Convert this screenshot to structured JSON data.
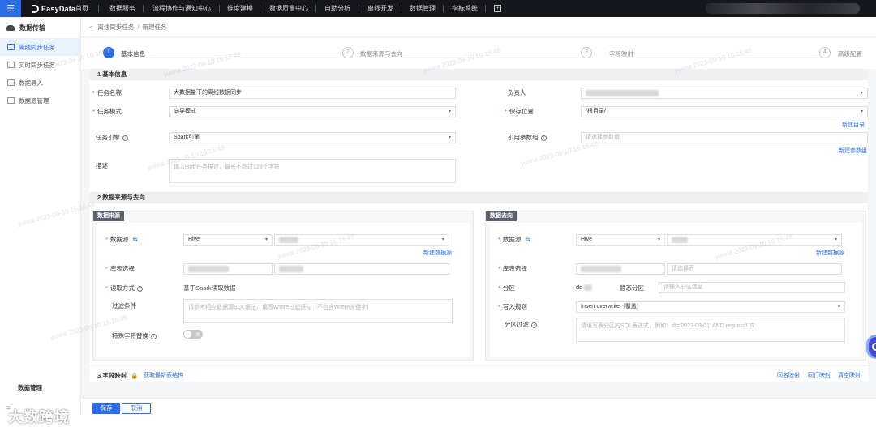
{
  "topbar": {
    "menu_icon": "☰",
    "logo_text": "EasyData",
    "nav": [
      "首页",
      "数据服务",
      "流程协作与通知中心",
      "维度建模",
      "数据质量中心",
      "自助分析",
      "离线开发",
      "数据管理",
      "指标系统"
    ],
    "plus_icon": "+"
  },
  "sidebar": {
    "title": "数据传输",
    "items": [
      {
        "label": "离线同步任务",
        "active": true
      },
      {
        "label": "实时同步任务",
        "active": false
      },
      {
        "label": "数据导入",
        "active": false
      },
      {
        "label": "数据源管理",
        "active": false
      }
    ],
    "bottom_label": "数据管理",
    "toggle": "≡"
  },
  "watermark_brand": "大数跨境",
  "breadcrumb": {
    "back": "<",
    "parent": "离线同步任务",
    "sep": "/",
    "current": "新建任务"
  },
  "steps": [
    {
      "num": "1",
      "label": "基本信息",
      "active": true
    },
    {
      "num": "2",
      "label": "数据来源与去向",
      "active": false
    },
    {
      "num": "3",
      "label": "字段映射",
      "active": false
    },
    {
      "num": "4",
      "label": "高级配置",
      "active": false
    }
  ],
  "basic": {
    "section_title": "1 基本信息",
    "task_name_label": "任务名称",
    "task_name_value": "大数据量下的离线数据同步",
    "task_mode_label": "任务模式",
    "task_mode_value": "向导模式",
    "engine_label": "任务引擎",
    "engine_value": "Spark引擎",
    "desc_label": "描述",
    "desc_placeholder": "输入同步任务描述，最长不超过128个字符",
    "owner_label": "负责人",
    "owner_value": "",
    "save_pos_label": "保存位置",
    "save_pos_value": "/根目录/",
    "new_dir_link": "新建目录",
    "param_group_label": "引用参数组",
    "param_group_placeholder": "请选择参数组",
    "new_param_link": "新建参数组"
  },
  "source_dest": {
    "section_title": "2 数据来源与去向",
    "source": {
      "tag": "数据来源",
      "ds_label": "数据源",
      "ds_type": "Hive",
      "new_ds_link": "新建数据源",
      "table_label": "库表选择",
      "read_label": "读取方式",
      "read_value": "基于Spark读取数据",
      "filter_label": "过滤条件",
      "filter_placeholder": "请参考相应数据源SQL语法，填写where过滤语句（不包含where关键字）",
      "special_char_label": "特殊字符替换",
      "switch_text": "关"
    },
    "dest": {
      "tag": "数据去向",
      "ds_label": "数据源",
      "ds_type": "Hive",
      "new_ds_link": "新建数据源",
      "table_label": "库表选择",
      "table_placeholder": "请选择表",
      "partition_label": "分区",
      "partition_prefix": "dq",
      "static_part_label": "静态分区",
      "static_part_placeholder": "请输入分区信息",
      "write_label": "写入规则",
      "write_value": "Insert overwrite（覆盖）",
      "part_filter_label": "分区过滤",
      "part_filter_placeholder": "请填写表分区的SQL表达式，例如：dt='2023-08-01' AND region='US'"
    }
  },
  "mapping": {
    "section_title": "3 字段映射",
    "fetch_link": "获取最新表结构",
    "same_name": "同名映射",
    "same_row": "同行映射",
    "clear": "清空映射"
  },
  "footer": {
    "save": "保存",
    "cancel": "取消"
  },
  "watermark_text": "yunna 2023-09-10 16:16:48",
  "colors": {
    "accent": "#2b6de8",
    "topbar": "#16171d",
    "required": "#e74c3c"
  }
}
